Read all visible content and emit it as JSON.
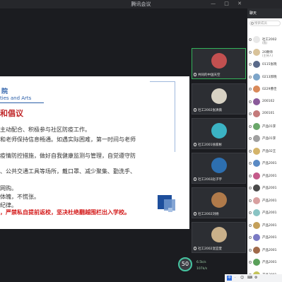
{
  "window": {
    "title": "腾讯会议",
    "controls": "— □ ✕"
  },
  "slide": {
    "institute": "院",
    "institute_en": "ties and Arts",
    "heading": "和倡议",
    "lines": [
      "主动配合、积极参与社区防疫工作。",
      "和老师保持信息畅通。如遇实际困难，第一时间与老师",
      "疫情防控措施，做好自我健康监测与管理，自觉遵守防",
      "、公共交通工具等场所，戴口罩、减少聚集、勤洗手、",
      "网购。",
      "体魄，不慌张。",
      "纪律。"
    ],
    "warning": "，严禁私自提前返校，坚决杜绝翻越围栏出入学校。"
  },
  "tiles": [
    {
      "name": "共同的中国天空",
      "color": "#c25050",
      "active": true
    },
    {
      "name": "社工2002张清薇",
      "color": "#d8d2c4",
      "active": false
    },
    {
      "name": "社工2001徐家彬",
      "color": "#3bb3c4",
      "active": false
    },
    {
      "name": "社工2002赵子宇",
      "color": "#2d6fb0",
      "active": false
    },
    {
      "name": "社工2002刘杨",
      "color": "#b07a4a",
      "active": false
    },
    {
      "name": "社工2002温宜萱",
      "color": "#c9b08a",
      "active": false
    }
  ],
  "network": {
    "value": "50",
    "up": "6.5k/s",
    "down": "107k/s"
  },
  "chat": {
    "title": "聊天",
    "search_placeholder": "搜索成员",
    "members": [
      {
        "name": "社工2002",
        "sub": "(我)",
        "color": "#e8e8e8"
      },
      {
        "name": "20教师",
        "sub": "(主持人)",
        "color": "#d9c39a"
      },
      {
        "name": "0115张晓",
        "sub": "",
        "color": "#5a6a8a"
      },
      {
        "name": "0213郭晓",
        "sub": "",
        "color": "#7da5c9"
      },
      {
        "name": "0229曹佳",
        "sub": "",
        "color": "#d98a5a"
      },
      {
        "name": "200102",
        "sub": "",
        "color": "#8a5a9a"
      },
      {
        "name": "200101",
        "sub": "",
        "color": "#c47a7a"
      },
      {
        "name": "产品01李",
        "sub": "",
        "color": "#6aa76a"
      },
      {
        "name": "产品01李",
        "sub": "",
        "color": "#a0a0a0"
      },
      {
        "name": "产品02王",
        "sub": "",
        "color": "#d4b46a"
      },
      {
        "name": "产品2001",
        "sub": "",
        "color": "#5a8ac4"
      },
      {
        "name": "产品2001",
        "sub": "",
        "color": "#c45a8a"
      },
      {
        "name": "产品2001",
        "sub": "",
        "color": "#4a4a4a"
      },
      {
        "name": "产品2001",
        "sub": "",
        "color": "#d8a0a0"
      },
      {
        "name": "产品2001",
        "sub": "",
        "color": "#8ac4c4"
      },
      {
        "name": "产品2001",
        "sub": "",
        "color": "#c4a05a"
      },
      {
        "name": "产品2001",
        "sub": "",
        "color": "#7a7ac4"
      },
      {
        "name": "产品2001",
        "sub": "",
        "color": "#a06a4a"
      },
      {
        "name": "产品2001",
        "sub": "",
        "color": "#5aa05a"
      },
      {
        "name": "产品2001",
        "sub": "",
        "color": "#c4c45a"
      }
    ]
  },
  "ime": {
    "badge": "中",
    "items": [
      "·",
      "☺",
      "⌨",
      "⚙"
    ]
  }
}
